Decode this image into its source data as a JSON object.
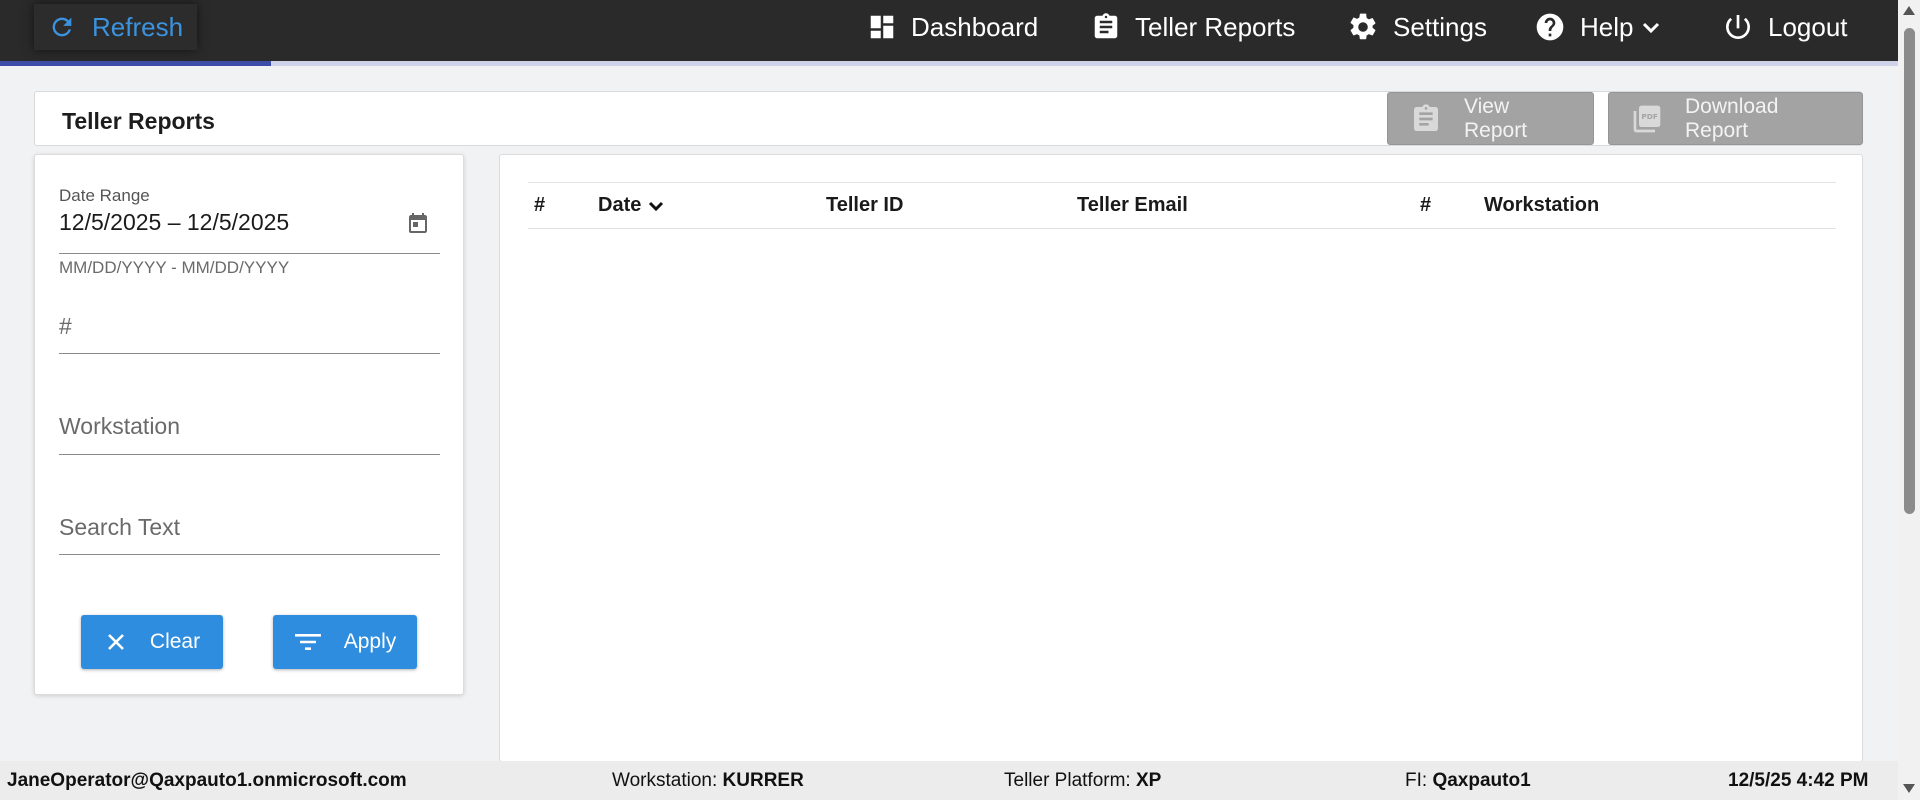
{
  "topbar": {
    "refresh_label": "Refresh",
    "nav": {
      "dashboard": "Dashboard",
      "teller_reports": "Teller Reports",
      "settings": "Settings",
      "help": "Help",
      "logout": "Logout"
    }
  },
  "header": {
    "title": "Teller Reports",
    "view_report": "View Report",
    "download_report": "Download Report"
  },
  "filters": {
    "date_range_label": "Date Range",
    "date_range_value": "12/5/2025 – 12/5/2025",
    "date_range_hint": "MM/DD/YYYY - MM/DD/YYYY",
    "number_placeholder": "#",
    "workstation_placeholder": "Workstation",
    "search_placeholder": "Search Text",
    "clear_label": "Clear",
    "apply_label": "Apply"
  },
  "table": {
    "columns": [
      "#",
      "Date",
      "Teller ID",
      "Teller Email",
      "#",
      "Workstation"
    ],
    "rows": []
  },
  "footer": {
    "user": "JaneOperator@Qaxpauto1.onmicrosoft.com",
    "workstation_label": "Workstation:",
    "workstation_value": "KURRER",
    "platform_label": "Teller Platform:",
    "platform_value": "XP",
    "fi_label": "FI:",
    "fi_value": "Qaxpauto1",
    "datetime": "12/5/25 4:42 PM"
  },
  "icons": {
    "refresh": "refresh-icon",
    "dashboard": "dashboard-icon",
    "teller_reports": "clipboard-icon",
    "settings": "gear-icon",
    "help": "help-circle-icon",
    "help_caret": "chevron-down-icon",
    "logout": "power-icon",
    "view_report": "clipboard-icon",
    "download_report": "pdf-icon",
    "calendar": "calendar-icon",
    "clear": "close-icon",
    "apply": "filter-icon",
    "sort": "chevron-down-icon"
  },
  "colors": {
    "topbar_bg": "#2a2a2a",
    "accent_blue": "#3b93e0",
    "primary_button": "#2f8ddf",
    "disabled_button": "#a3a3a3",
    "progress_indicator": "#3d4ea8"
  }
}
